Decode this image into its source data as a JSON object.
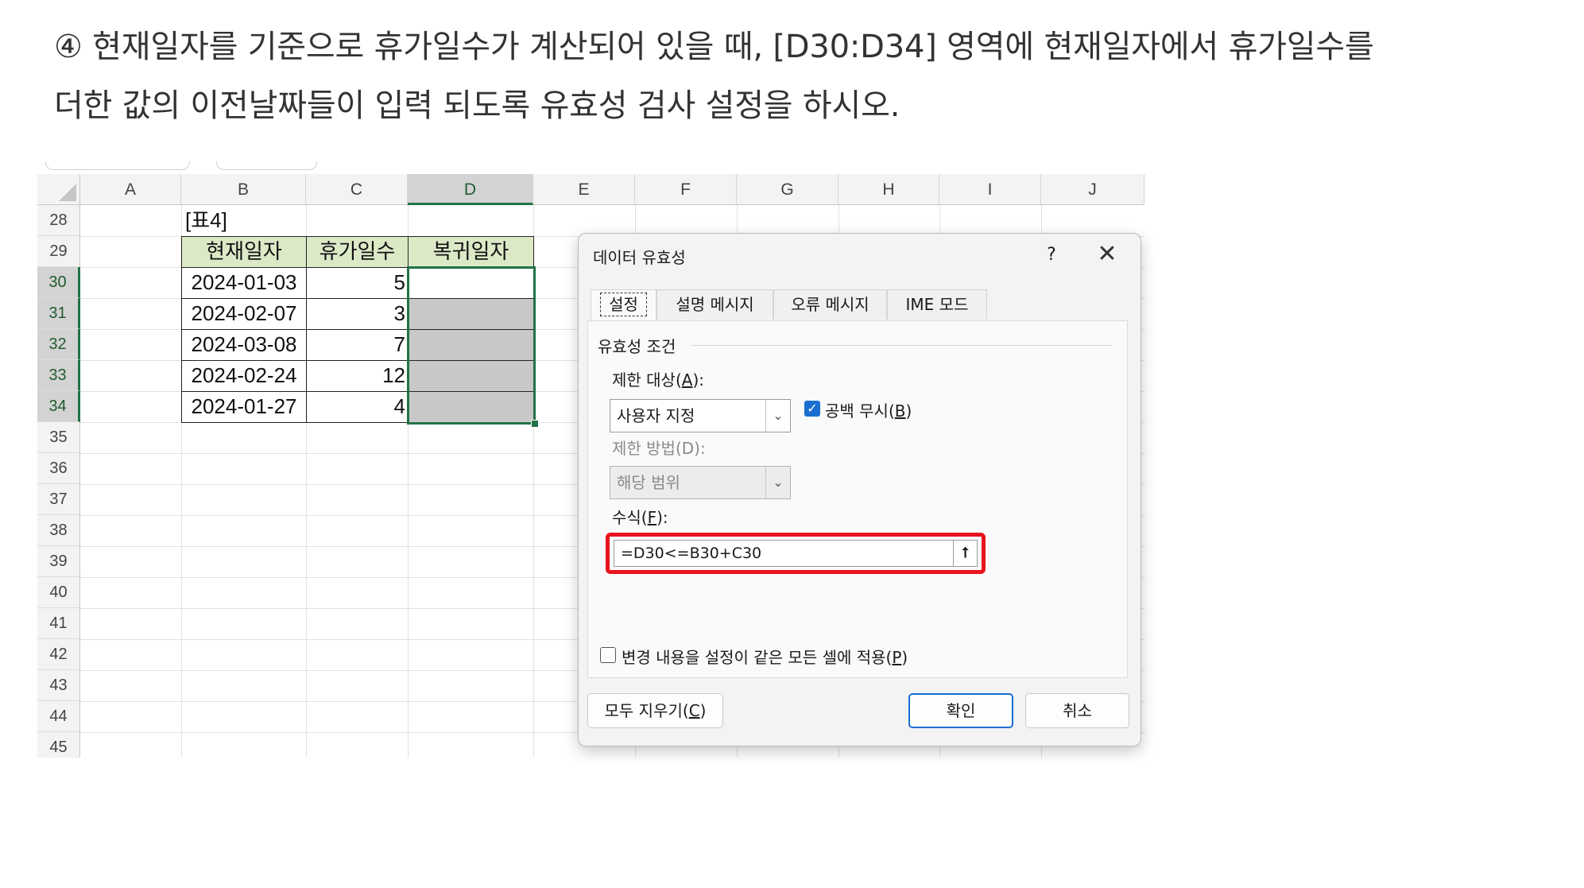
{
  "instruction": {
    "line1": "④ 현재일자를 기준으로 휴가일수가 계산되어 있을 때, [D30:D34] 영역에 현재일자에서 휴가일수를",
    "line2": "더한 값의 이전날짜들이 입력 되도록 유효성 검사 설정을 하시오."
  },
  "sheet": {
    "columns": [
      "A",
      "B",
      "C",
      "D",
      "E",
      "F",
      "G",
      "H",
      "I",
      "J"
    ],
    "selected_column": "D",
    "rows": [
      "28",
      "29",
      "30",
      "31",
      "32",
      "33",
      "34",
      "35",
      "36",
      "37",
      "38",
      "39",
      "40",
      "41",
      "42",
      "43",
      "44",
      "45"
    ],
    "selected_rows": [
      "30",
      "31",
      "32",
      "33",
      "34"
    ],
    "table_label": "[표4]",
    "headers": [
      "현재일자",
      "휴가일수",
      "복귀일자"
    ],
    "data": [
      {
        "date": "2024-01-03",
        "days": "5"
      },
      {
        "date": "2024-02-07",
        "days": "3"
      },
      {
        "date": "2024-03-08",
        "days": "7"
      },
      {
        "date": "2024-02-24",
        "days": "12"
      },
      {
        "date": "2024-01-27",
        "days": "4"
      }
    ]
  },
  "dialog": {
    "title": "데이터 유효성",
    "help": "?",
    "close": "✕",
    "tabs": [
      "설정",
      "설명 메시지",
      "오류 메시지",
      "IME 모드"
    ],
    "active_tab": "설정",
    "group_label": "유효성 조건",
    "allow_label": "제한 대상(",
    "allow_key": "A",
    "allow_value": "사용자 지정",
    "ignore_blank_label": "공백 무시(",
    "ignore_blank_key": "B",
    "ignore_blank_checked": true,
    "data_label": "제한 방법(D):",
    "data_value": "해당 범위",
    "formula_label": "수식(",
    "formula_key": "F",
    "formula_value": "=D30<=B30+C30",
    "apply_all_label": "변경 내용을 설정이 같은 모든 셀에 적용(",
    "apply_all_key": "P",
    "apply_all_checked": false,
    "clear_all_label": "모두 지우기(",
    "clear_all_key": "C",
    "ok_label": "확인",
    "cancel_label": "취소"
  },
  "colors": {
    "excel_green": "#217346",
    "header_fill": "#dce9c7",
    "highlight_red": "#e8141c",
    "check_blue": "#1a6fd0"
  }
}
